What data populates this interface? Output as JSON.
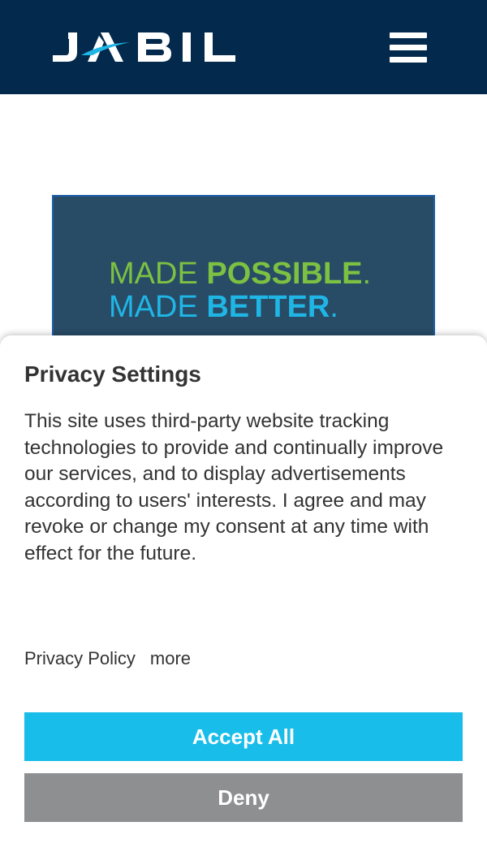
{
  "header": {
    "logo_text": "JABIL",
    "menu_icon": "hamburger-menu-icon",
    "background": "#032a4d"
  },
  "banner": {
    "line1_light": "MADE ",
    "line1_bold": "POSSIBLE",
    "line1_end": ".",
    "line2_light": "MADE ",
    "line2_bold": "BETTER",
    "line2_end": ".",
    "color_green": "#7cc142",
    "color_blue": "#1fb6e6"
  },
  "privacy": {
    "title": "Privacy Settings",
    "body": "This site uses third-party website tracking technologies to provide and continually improve our services, and to display advertisements according to users' interests. I agree and may revoke or change my consent at any time with effect for the future.",
    "policy_link": "Privacy Policy",
    "more_link": "more",
    "accept_label": "Accept All",
    "deny_label": "Deny",
    "accept_color": "#19bde9",
    "deny_color": "#8e8f91"
  }
}
